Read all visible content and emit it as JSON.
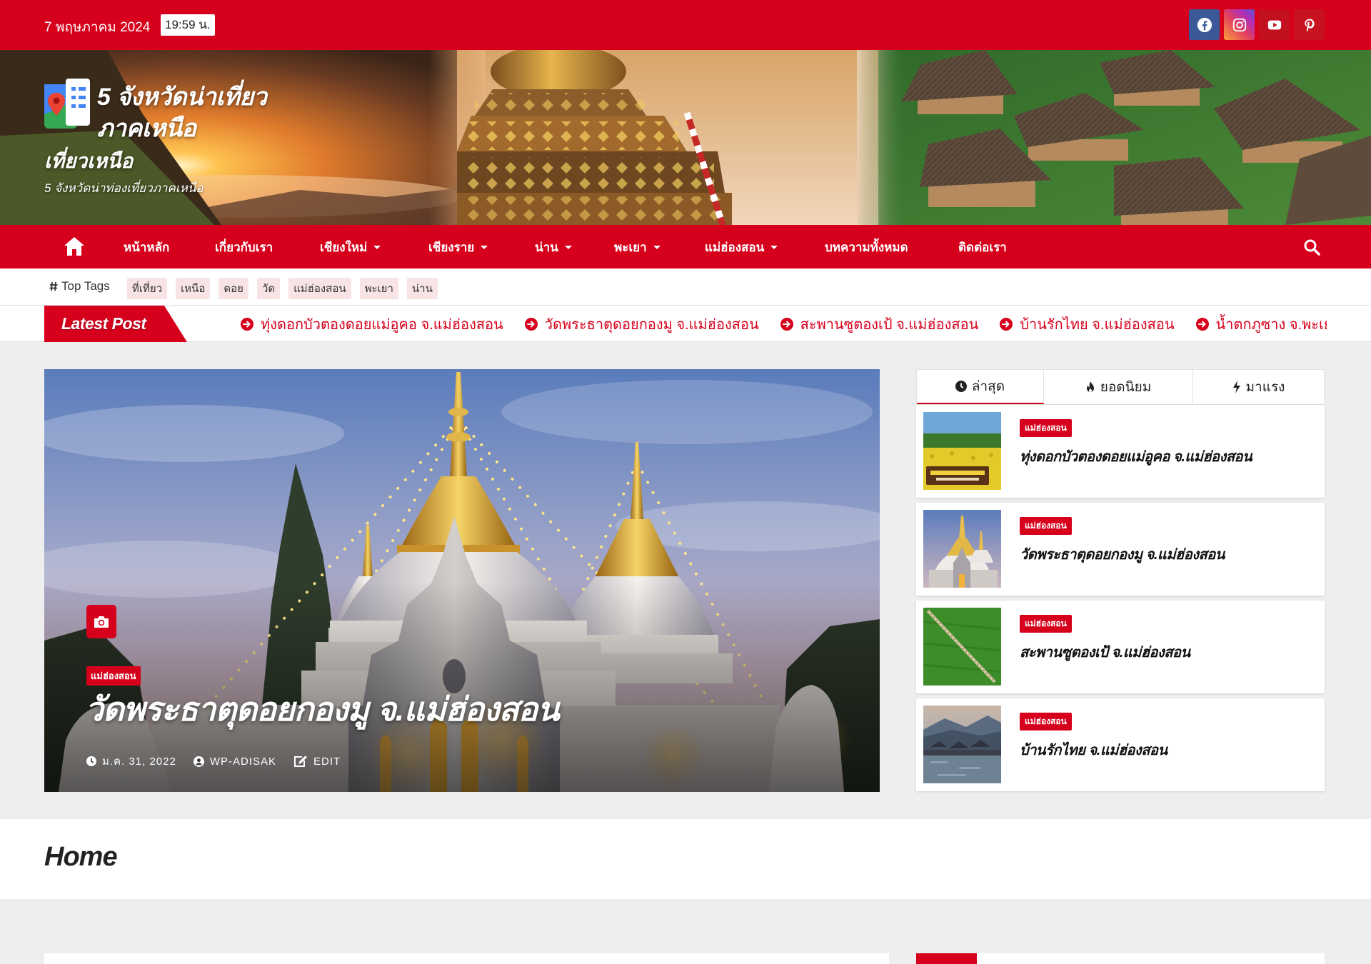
{
  "colors": {
    "accent": "#d6001c",
    "facebook": "#3b5998",
    "youtube": "#c2101e",
    "page_background": "#eeeeee",
    "text_dark": "#222222"
  },
  "topbar": {
    "date": "7 พฤษภาคม 2024",
    "time": "19:59 น.",
    "social_icons": [
      "facebook-icon",
      "instagram-icon",
      "youtube-icon",
      "pinterest-icon"
    ]
  },
  "site": {
    "logo_line1": "5 จังหวัดน่าเที่ยว",
    "logo_line2": "ภาคเหนือ",
    "name": "เที่ยวเหนือ",
    "tagline": "5 จังหวัดน่าท่องเที่ยวภาคเหนือ"
  },
  "nav": {
    "home_icon": "home-icon",
    "search_icon": "search-icon",
    "items": [
      {
        "label": "หน้าหลัก",
        "dropdown": false
      },
      {
        "label": "เกี่ยวกับเรา",
        "dropdown": false
      },
      {
        "label": "เชียงใหม่",
        "dropdown": true
      },
      {
        "label": "เชียงราย",
        "dropdown": true
      },
      {
        "label": "น่าน",
        "dropdown": true
      },
      {
        "label": "พะเยา",
        "dropdown": true
      },
      {
        "label": "แม่ฮ่องสอน",
        "dropdown": true
      },
      {
        "label": "บทความทั้งหมด",
        "dropdown": false
      },
      {
        "label": "ติดต่อเรา",
        "dropdown": false
      }
    ]
  },
  "top_tags": {
    "label": "Top Tags",
    "tags": [
      "ที่เที่ยว",
      "เหนือ",
      "ดอย",
      "วัด",
      "แม่ฮ่องสอน",
      "พะเยา",
      "น่าน"
    ]
  },
  "ticker": {
    "label": "Latest Post",
    "items": [
      "ทุ่งดอกบัวตองดอยแม่อูคอ จ.แม่ฮ่องสอน",
      "วัดพระธาตุดอยกองมู จ.แม่ฮ่องสอน",
      "สะพานซูตองเป้ จ.แม่ฮ่องสอน",
      "บ้านรักไทย จ.แม่ฮ่องสอน",
      "น้ำตกภูซาง จ.พะเยา"
    ]
  },
  "featured": {
    "category": "แม่ฮ่องสอน",
    "title": "วัดพระธาตุดอยกองมู จ.แม่ฮ่องสอน",
    "date": "ม.ค. 31, 2022",
    "author": "WP-ADISAK",
    "edit": "EDIT"
  },
  "sidebar": {
    "tabs": [
      {
        "label": "ล่าสุด",
        "icon": "clock-icon",
        "active": true
      },
      {
        "label": "ยอดนิยม",
        "icon": "fire-icon",
        "active": false
      },
      {
        "label": "มาแรง",
        "icon": "bolt-icon",
        "active": false
      }
    ],
    "posts": [
      {
        "category": "แม่ฮ่องสอน",
        "title": "ทุ่งดอกบัวตองดอยแม่อูคอ จ.แม่ฮ่องสอน"
      },
      {
        "category": "แม่ฮ่องสอน",
        "title": "วัดพระธาตุดอยกองมู จ.แม่ฮ่องสอน"
      },
      {
        "category": "แม่ฮ่องสอน",
        "title": "สะพานซูตองเป้ จ.แม่ฮ่องสอน"
      },
      {
        "category": "แม่ฮ่องสอน",
        "title": "บ้านรักไทย จ.แม่ฮ่องสอน"
      }
    ]
  },
  "page": {
    "title": "Home"
  }
}
